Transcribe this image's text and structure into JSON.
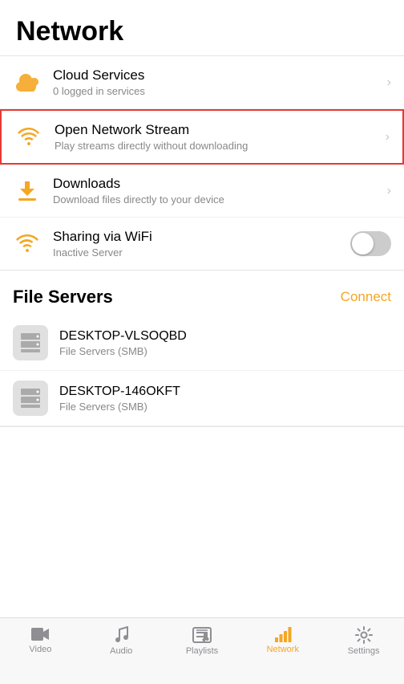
{
  "header": {
    "title": "Network"
  },
  "menu_items": [
    {
      "id": "cloud-services",
      "title": "Cloud Services",
      "subtitle": "0 logged in services",
      "icon": "cloud",
      "has_chevron": true,
      "highlighted": false
    },
    {
      "id": "open-network-stream",
      "title": "Open Network Stream",
      "subtitle": "Play streams directly without downloading",
      "icon": "wifi-stream",
      "has_chevron": true,
      "highlighted": true
    },
    {
      "id": "downloads",
      "title": "Downloads",
      "subtitle": "Download files directly to your device",
      "icon": "download",
      "has_chevron": true,
      "highlighted": false
    },
    {
      "id": "sharing-wifi",
      "title": "Sharing via WiFi",
      "subtitle": "Inactive Server",
      "icon": "wifi",
      "has_chevron": false,
      "has_toggle": true,
      "highlighted": false
    }
  ],
  "file_servers_section": {
    "title": "File Servers",
    "connect_label": "Connect",
    "servers": [
      {
        "id": "server-1",
        "name": "DESKTOP-VLSOQBD",
        "type": "File Servers (SMB)"
      },
      {
        "id": "server-2",
        "name": "DESKTOP-146OKFT",
        "type": "File Servers (SMB)"
      }
    ]
  },
  "tab_bar": {
    "tabs": [
      {
        "id": "video",
        "label": "Video",
        "icon": "video",
        "active": false
      },
      {
        "id": "audio",
        "label": "Audio",
        "icon": "music",
        "active": false
      },
      {
        "id": "playlists",
        "label": "Playlists",
        "icon": "list",
        "active": false
      },
      {
        "id": "network",
        "label": "Network",
        "icon": "network",
        "active": true
      },
      {
        "id": "settings",
        "label": "Settings",
        "icon": "gear",
        "active": false
      }
    ]
  },
  "colors": {
    "accent": "#f5a623",
    "highlight_border": "#e53935",
    "text_primary": "#000",
    "text_secondary": "#888",
    "chevron": "#c7c7cc"
  }
}
